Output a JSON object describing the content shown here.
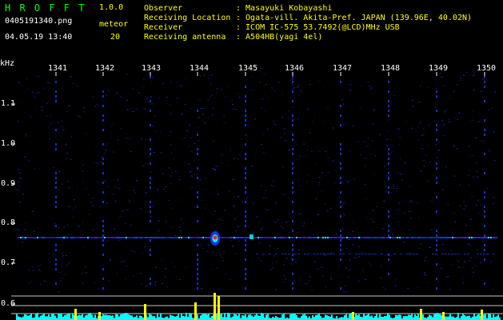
{
  "app": {
    "name": "H R O F F T",
    "version": "1.0.0",
    "filename": "0405191340.png",
    "datetime": "04.05.19 13:40",
    "meteor_label": "meteor",
    "meteor_count": "20"
  },
  "info": {
    "rows": [
      {
        "label": "Observer",
        "value": ": Masayuki Kobayashi"
      },
      {
        "label": "Receiving Location",
        "value": ": Ogata-vill. Akita-Pref. JAPAN (139.96E, 40.02N)"
      },
      {
        "label": "Receiver",
        "value": ": ICOM IC-575 53.7492(@LCD)MHz USB"
      },
      {
        "label": "Receiving antenna",
        "value": ": A504HB(yagi 4el)"
      }
    ]
  },
  "axes": {
    "y_unit": "kHz",
    "x_ticks": [
      "1341",
      "1342",
      "1343",
      "1344",
      "1345",
      "1346",
      "1347",
      "1348",
      "1349",
      "1350"
    ],
    "y_ticks": [
      "1.1",
      "1.0",
      "0.9",
      "0.8",
      "0.7",
      "0.6"
    ]
  },
  "colors": {
    "header_green": "#00ff00",
    "header_yellow": "#ffff00",
    "background": "#000000",
    "signal_blue": "#1a3cff",
    "signal_cyan": "#00ffff",
    "signal_yellow": "#ffff00",
    "signal_red": "#ff2020"
  }
}
